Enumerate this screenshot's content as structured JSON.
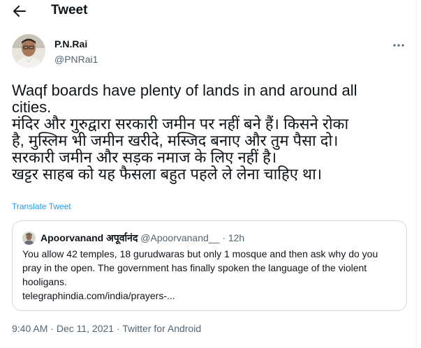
{
  "header": {
    "title": "Tweet"
  },
  "author": {
    "name": "P.N.Rai",
    "handle": "@PNRai1"
  },
  "tweet": {
    "lines": [
      "Waqf boards have plenty of lands in and around all",
      "cities.",
      "मंदिर और गुरुद्वारा सरकारी जमीन पर नहीं बने हैं। किसने रोका",
      "है, मुस्लिम भी जमीन खरीदे, मस्जिद बनाए और तुम पैसा दो।",
      "सरकारी जमीन और सड़क नमाज के लिए नहीं है।",
      "खट्टर साहब को यह फैसला बहुत पहले ले लेना चाहिए था।"
    ],
    "translate_label": "Translate Tweet"
  },
  "quote": {
    "name": "Apoorvanand अपूर्वानंद",
    "handle": "@Apoorvanand__",
    "separator": "·",
    "time": "12h",
    "lines": [
      "You allow 42 temples, 18 gurudwaras but only 1 mosque and then ask why do you",
      "pray in the open. The government has finally spoken the language of the violent",
      "hooligans.",
      "telegraphindia.com/india/prayers-..."
    ]
  },
  "meta": {
    "time": "9:40 AM",
    "separator1": " · ",
    "date": "Dec 11, 2021",
    "separator2": " · ",
    "source": "Twitter for Android"
  },
  "icons": {
    "back": "arrow-left-icon",
    "more": "more-horizontal-icon"
  },
  "colors": {
    "text": "#0f1419",
    "secondary": "#536471",
    "link": "#1d9bf0",
    "border": "#cfd9de"
  }
}
